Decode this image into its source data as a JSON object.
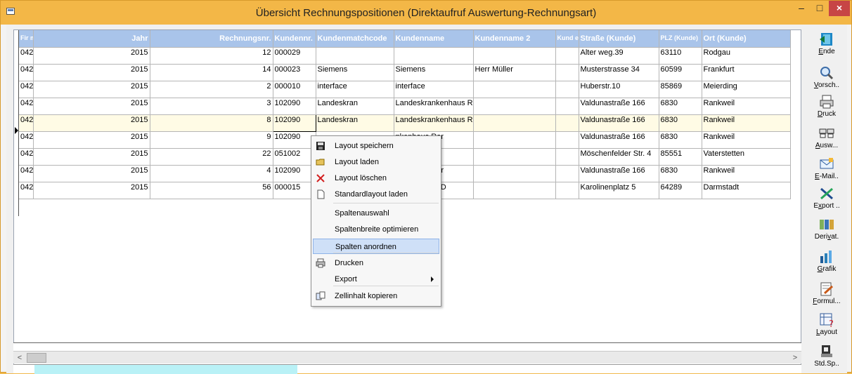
{
  "window": {
    "title": "Übersicht Rechnungspositionen (Direktaufruf Auswertung-Rechnungsart)",
    "controls": {
      "minimize": "–",
      "maximize": "□",
      "close": "×"
    }
  },
  "grid": {
    "columns": [
      {
        "key": "firm",
        "label": "Fir m"
      },
      {
        "key": "jahr",
        "label": "Jahr"
      },
      {
        "key": "rechnungsnr",
        "label": "Rechnungsnr."
      },
      {
        "key": "kundennr",
        "label": "Kundennr."
      },
      {
        "key": "matchcode",
        "label": "Kundenmatchcode"
      },
      {
        "key": "kundenname",
        "label": "Kundenname"
      },
      {
        "key": "kundenname2",
        "label": "Kundenname 2"
      },
      {
        "key": "kundenna",
        "label": "Kund enna"
      },
      {
        "key": "strasse",
        "label": "Straße (Kunde)"
      },
      {
        "key": "plz",
        "label": "PLZ (Kunde)"
      },
      {
        "key": "ort",
        "label": "Ort (Kunde)"
      }
    ],
    "rows": [
      {
        "firm": "042",
        "jahr": "2015",
        "rechnungsnr": "12",
        "kundennr": "000029",
        "matchcode": "",
        "kundenname": "",
        "kundenname2": "",
        "kundenna": "",
        "strasse": "Alter weg.39",
        "plz": "63110",
        "ort": "Rodgau"
      },
      {
        "firm": "042",
        "jahr": "2015",
        "rechnungsnr": "14",
        "kundennr": "000023",
        "matchcode": "Siemens",
        "kundenname": "Siemens",
        "kundenname2": "Herr Müller",
        "kundenna": "",
        "strasse": "Musterstrasse 34",
        "plz": "60599",
        "ort": "Frankfurt"
      },
      {
        "firm": "042",
        "jahr": "2015",
        "rechnungsnr": "2",
        "kundennr": "000010",
        "matchcode": "interface",
        "kundenname": "interface",
        "kundenname2": "",
        "kundenna": "",
        "strasse": "Huberstr.10",
        "plz": "85869",
        "ort": "Meierding"
      },
      {
        "firm": "042",
        "jahr": "2015",
        "rechnungsnr": "3",
        "kundennr": "102090",
        "matchcode": "Landeskran",
        "kundenname": "Landeskrankenhaus Rar",
        "kundenname2": "",
        "kundenna": "",
        "strasse": "Valdunastraße 166",
        "plz": "6830",
        "ort": "Rankweil"
      },
      {
        "firm": "042",
        "jahr": "2015",
        "rechnungsnr": "8",
        "kundennr": "102090",
        "matchcode": "Landeskran",
        "kundenname": "Landeskrankenhaus Rar",
        "kundenname2": "",
        "kundenna": "",
        "strasse": "Valdunastraße 166",
        "plz": "6830",
        "ort": "Rankweil"
      },
      {
        "firm": "042",
        "jahr": "2015",
        "rechnungsnr": "9",
        "kundennr": "102090",
        "matchcode": "",
        "kundenname": "nkenhaus Rar",
        "kundenname2": "",
        "kundenna": "",
        "strasse": "Valdunastraße 166",
        "plz": "6830",
        "ort": "Rankweil"
      },
      {
        "firm": "042",
        "jahr": "2015",
        "rechnungsnr": "22",
        "kundennr": "051002",
        "matchcode": "",
        "kundenname": "amt",
        "kundenname2": "",
        "kundenna": "",
        "strasse": "Möschenfelder Str. 4",
        "plz": "85551",
        "ort": "Vaterstetten"
      },
      {
        "firm": "042",
        "jahr": "2015",
        "rechnungsnr": "4",
        "kundennr": "102090",
        "matchcode": "",
        "kundenname": "nkenhaus Rar",
        "kundenname2": "",
        "kundenna": "",
        "strasse": "Valdunastraße 166",
        "plz": "6830",
        "ort": "Rankweil"
      },
      {
        "firm": "042",
        "jahr": "2015",
        "rechnungsnr": "56",
        "kundennr": "000015",
        "matchcode": "",
        "kundenname": "e Universität D",
        "kundenname2": "",
        "kundenna": "",
        "strasse": "Karolinenplatz 5",
        "plz": "64289",
        "ort": "Darmstadt"
      }
    ]
  },
  "toolbar": [
    {
      "name": "ende",
      "pre": "",
      "u": "E",
      "post": "nde"
    },
    {
      "name": "vorsch",
      "pre": "",
      "u": "V",
      "post": "orsch.."
    },
    {
      "name": "druck",
      "pre": "",
      "u": "D",
      "post": "ruck"
    },
    {
      "name": "ausw",
      "pre": "",
      "u": "A",
      "post": "usw..."
    },
    {
      "name": "email",
      "pre": "",
      "u": "E",
      "post": "-Mail.."
    },
    {
      "name": "export",
      "pre": "E",
      "u": "x",
      "post": "port .."
    },
    {
      "name": "derivat",
      "pre": "Deri",
      "u": "v",
      "post": "at."
    },
    {
      "name": "grafik",
      "pre": "",
      "u": "G",
      "post": "rafik"
    },
    {
      "name": "formul",
      "pre": "",
      "u": "F",
      "post": "ormul..."
    },
    {
      "name": "layout",
      "pre": "",
      "u": "L",
      "post": "ayout"
    },
    {
      "name": "stdsp",
      "pre": "Std.Sp..",
      "u": "",
      "post": ""
    }
  ],
  "context_menu": {
    "items": [
      {
        "label": "Layout speichern",
        "icon": "save-icon"
      },
      {
        "label": "Layout laden",
        "icon": "folder-open-icon"
      },
      {
        "label": "Layout löschen",
        "icon": "delete-icon"
      },
      {
        "label": "Standardlayout laden",
        "icon": "document-icon"
      },
      {
        "label": "Spaltenauswahl",
        "icon": ""
      },
      {
        "label": "Spaltenbreite optimieren",
        "icon": ""
      },
      {
        "label": "Spalten anordnen",
        "icon": "",
        "highlighted": true
      },
      {
        "label": "Drucken",
        "icon": "printer-icon"
      },
      {
        "label": "Export",
        "icon": "",
        "submenu": true
      },
      {
        "label": "Zellinhalt kopieren",
        "icon": "copy-icon"
      }
    ]
  },
  "scrollbar": {
    "left_arrow": "<",
    "right_arrow": ">"
  }
}
